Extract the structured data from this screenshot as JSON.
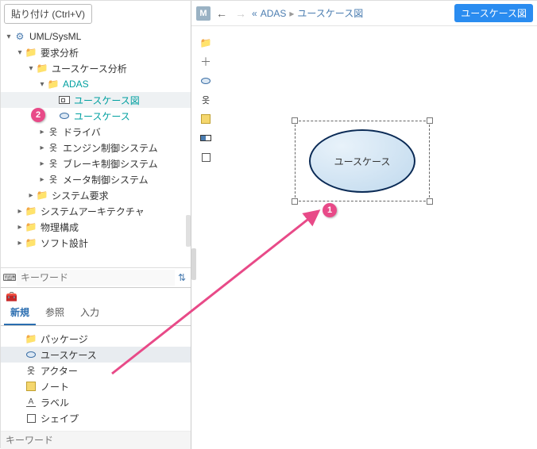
{
  "paste_tip": "貼り付け (Ctrl+V)",
  "tree": {
    "root_label": "UML/SysML",
    "items": [
      {
        "label": "要求分析"
      },
      {
        "label": "ユースケース分析"
      },
      {
        "label": "ADAS"
      },
      {
        "label": "ユースケース図"
      },
      {
        "label": "ユースケース"
      },
      {
        "label": "ドライバ"
      },
      {
        "label": "エンジン制御システム"
      },
      {
        "label": "ブレーキ制御システム"
      },
      {
        "label": "メータ制御システム"
      },
      {
        "label": "システム要求"
      },
      {
        "label": "システムアーキテクチャ"
      },
      {
        "label": "物理構成"
      },
      {
        "label": "ソフト設計"
      }
    ]
  },
  "search": {
    "placeholder": "キーワード"
  },
  "bottom": {
    "tabs": {
      "new": "新規",
      "ref": "参照",
      "input": "入力"
    },
    "items": [
      {
        "label": "パッケージ"
      },
      {
        "label": "ユースケース"
      },
      {
        "label": "アクター"
      },
      {
        "label": "ノート"
      },
      {
        "label": "ラベル"
      },
      {
        "label": "シェイプ"
      }
    ],
    "search_placeholder": "キーワード"
  },
  "canvas": {
    "m": "M",
    "breadcrumb_prefix": "«",
    "breadcrumb_1": "ADAS",
    "breadcrumb_sep": "▸",
    "breadcrumb_2": "ユースケース図",
    "badge": "ユースケース図",
    "shape_text": "ユースケース"
  },
  "annotations": {
    "b1": "1",
    "b2": "2"
  }
}
